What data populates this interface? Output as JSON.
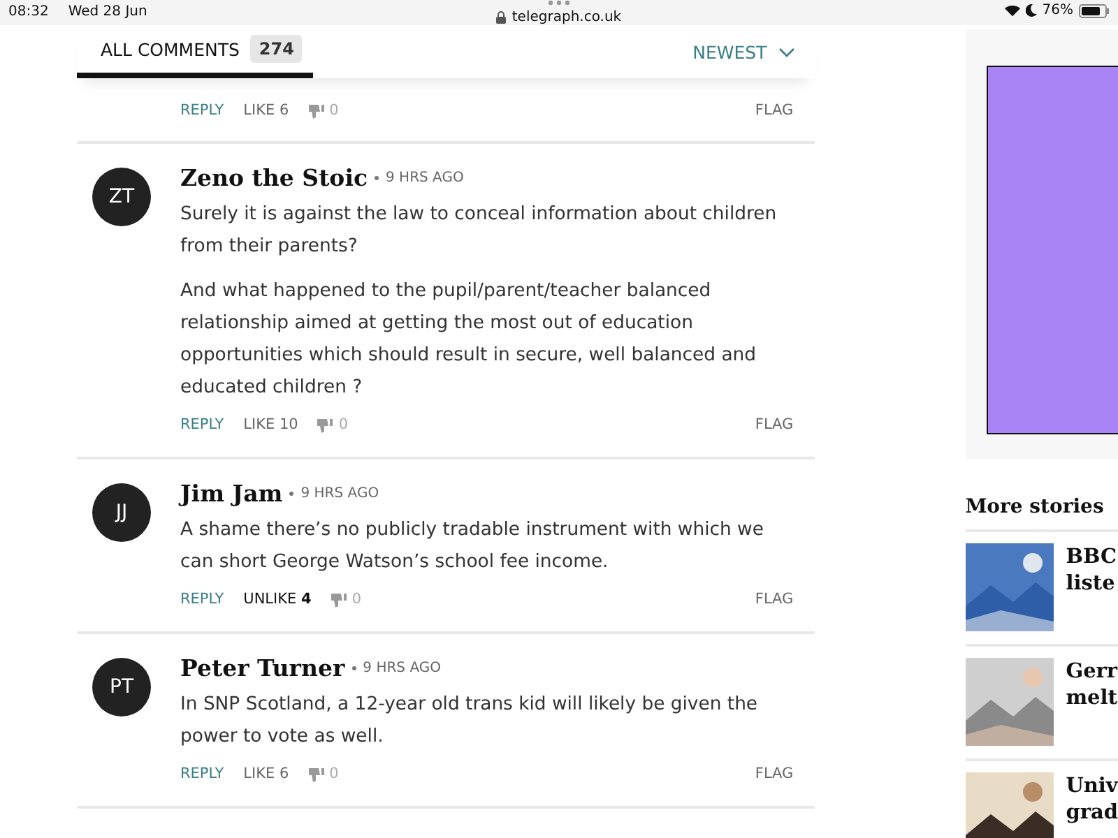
{
  "status_bar": {
    "time": "08:32",
    "date": "Wed 28 Jun",
    "url": "telegraph.co.uk",
    "battery": "76%"
  },
  "comments_header": {
    "tab": "ALL COMMENTS",
    "count": "274",
    "sort": "NEWEST"
  },
  "comments": [
    {
      "actions": {
        "reply": "REPLY",
        "like": "LIKE",
        "likes": "6",
        "liked": false,
        "dislikes": "0",
        "flag": "FLAG"
      }
    },
    {
      "initials": "ZT",
      "author": "Zeno the Stoic",
      "time": "9 HRS AGO",
      "paragraphs": [
        "Surely it is against the law to conceal information about children from their parents?",
        "And what happened to the pupil/parent/teacher balanced relationship aimed at getting the most out of education opportunities which should result in secure, well balanced and educated children ?"
      ],
      "actions": {
        "reply": "REPLY",
        "like": "LIKE",
        "likes": "10",
        "liked": false,
        "dislikes": "0",
        "flag": "FLAG"
      }
    },
    {
      "initials": "JJ",
      "author": "Jim Jam",
      "time": "9 HRS AGO",
      "paragraphs": [
        "A shame there’s no publicly tradable instrument with which we can short George Watson’s school fee income."
      ],
      "actions": {
        "reply": "REPLY",
        "like": "UNLIKE",
        "likes": "4",
        "liked": true,
        "dislikes": "0",
        "flag": "FLAG"
      }
    },
    {
      "initials": "PT",
      "author": "Peter Turner",
      "time": "9 HRS AGO",
      "paragraphs": [
        "In SNP Scotland, a 12-year old trans kid will likely be given the power to vote as well."
      ],
      "actions": {
        "reply": "REPLY",
        "like": "LIKE",
        "likes": "6",
        "liked": false,
        "dislikes": "0",
        "flag": "FLAG"
      }
    }
  ],
  "sidebar": {
    "more_stories": "More stories",
    "stories": [
      {
        "lines": [
          "BBC",
          "liste"
        ]
      },
      {
        "lines": [
          "Gerr",
          "melt"
        ]
      },
      {
        "lines": [
          "Univ",
          "grad"
        ]
      }
    ]
  }
}
